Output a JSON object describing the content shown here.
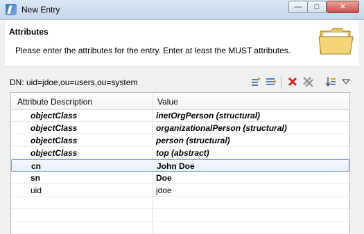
{
  "window": {
    "title": "New Entry"
  },
  "header": {
    "title": "Attributes",
    "description": "Please enter the attributes for the entry. Enter at least the MUST attributes."
  },
  "dn": {
    "label": "DN: uid=jdoe,ou=users,ou=system"
  },
  "toolbar": {
    "icons": [
      "new-attribute-icon",
      "new-value-icon",
      "delete-icon",
      "delete-all-icon",
      "sort-icon",
      "view-menu-icon"
    ]
  },
  "table": {
    "columns": [
      "Attribute Description",
      "Value"
    ],
    "rows": [
      {
        "attribute": "objectClass",
        "value": "inetOrgPerson (structural)"
      },
      {
        "attribute": "objectClass",
        "value": "organizationalPerson (structural)"
      },
      {
        "attribute": "objectClass",
        "value": "person (structural)"
      },
      {
        "attribute": "objectClass",
        "value": "top (abstract)"
      },
      {
        "attribute": "cn",
        "value": "John Doe"
      },
      {
        "attribute": "sn",
        "value": "Doe"
      },
      {
        "attribute": "uid",
        "value": "jdoe"
      }
    ]
  }
}
